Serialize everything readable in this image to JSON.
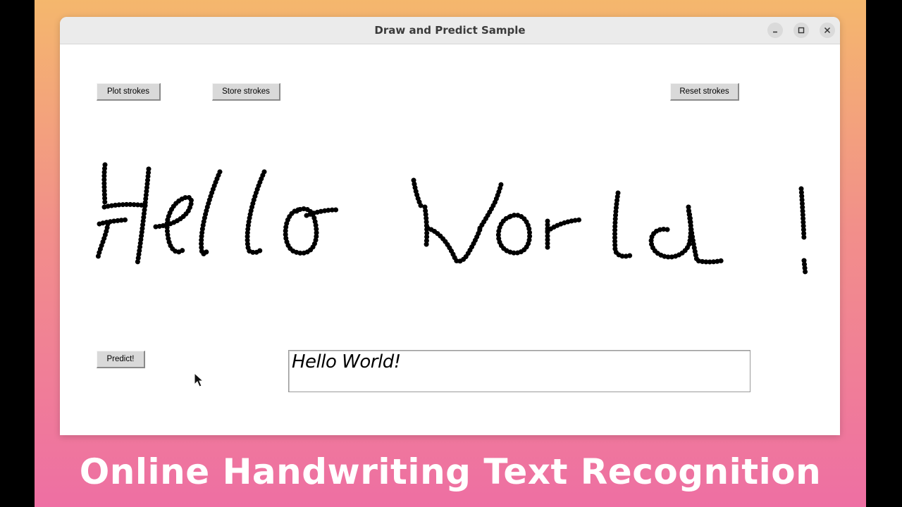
{
  "window": {
    "title": "Draw and Predict Sample",
    "controls": [
      "minimize-icon",
      "maximize-icon",
      "close-icon"
    ]
  },
  "toolbar": {
    "plot_label": "Plot strokes",
    "store_label": "Store strokes",
    "reset_label": "Reset strokes"
  },
  "canvas": {
    "content": "handwritten strokes",
    "stroke_color": "#000000"
  },
  "predict": {
    "button_label": "Predict!",
    "result": "Hello World!"
  },
  "caption": "Online Handwriting Text Recognition",
  "colors": {
    "gradient_top": "#f4b76d",
    "gradient_bottom": "#ee6fa3",
    "caption_text": "#ffffff"
  }
}
